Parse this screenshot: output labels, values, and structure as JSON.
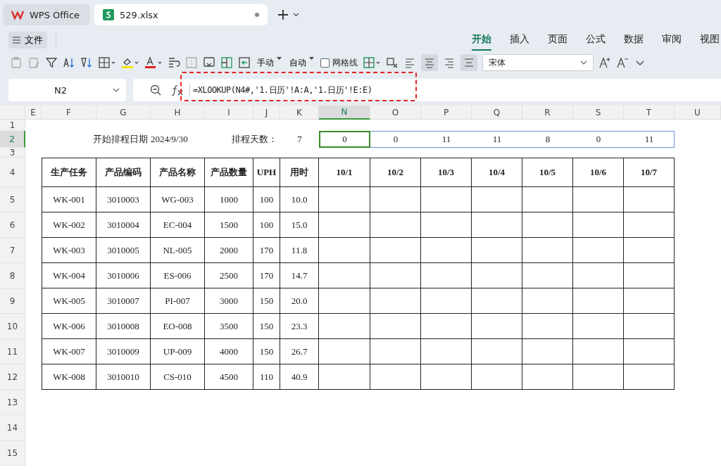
{
  "app_tabs": [
    {
      "kind": "home",
      "label": "WPS Office",
      "selected": false
    },
    {
      "kind": "file",
      "label": "529.xlsx",
      "selected": true
    }
  ],
  "menu_button": "文件",
  "ribbon_tabs": [
    {
      "label": "开始",
      "selected": true
    },
    {
      "label": "插入",
      "selected": false
    },
    {
      "label": "页面",
      "selected": false
    },
    {
      "label": "公式",
      "selected": false
    },
    {
      "label": "数据",
      "selected": false
    },
    {
      "label": "审阅",
      "selected": false
    },
    {
      "label": "视图",
      "selected": false
    }
  ],
  "toolbar": {
    "row_height": "手动",
    "col_width": "自动",
    "gridlines": {
      "label": "网格线",
      "checked": false
    },
    "font": "宋体"
  },
  "name_box": "N2",
  "formula": "=XLOOKUP(N4#,'1.日历'!A:A,'1.日历'!E:E)",
  "column_headers": [
    {
      "label": "E",
      "selected": false
    },
    {
      "label": "F",
      "selected": false
    },
    {
      "label": "G",
      "selected": false
    },
    {
      "label": "H",
      "selected": false
    },
    {
      "label": "I",
      "selected": false
    },
    {
      "label": "J",
      "selected": false
    },
    {
      "label": "K",
      "selected": false
    },
    {
      "label": "N",
      "selected": true
    },
    {
      "label": "O",
      "selected": false
    },
    {
      "label": "P",
      "selected": false
    },
    {
      "label": "Q",
      "selected": false
    },
    {
      "label": "R",
      "selected": false
    },
    {
      "label": "S",
      "selected": false
    },
    {
      "label": "T",
      "selected": false
    },
    {
      "label": "U",
      "selected": false
    }
  ],
  "row_headers": [
    {
      "label": "1",
      "selected": false
    },
    {
      "label": "2",
      "selected": true
    },
    {
      "label": "3",
      "selected": false
    },
    {
      "label": "4",
      "selected": false
    },
    {
      "label": "5",
      "selected": false
    },
    {
      "label": "6",
      "selected": false
    },
    {
      "label": "7",
      "selected": false
    },
    {
      "label": "8",
      "selected": false
    },
    {
      "label": "9",
      "selected": false
    },
    {
      "label": "10",
      "selected": false
    },
    {
      "label": "11",
      "selected": false
    },
    {
      "label": "12",
      "selected": false
    },
    {
      "label": "13",
      "selected": false
    },
    {
      "label": "14",
      "selected": false
    },
    {
      "label": "15",
      "selected": false
    }
  ],
  "schedule": {
    "start_label": "开始排程日期",
    "start_date": "2024/9/30",
    "days_label": "排程天数：",
    "days": "7",
    "day_values": [
      "0",
      "0",
      "11",
      "11",
      "8",
      "0",
      "11"
    ]
  },
  "table": {
    "columns": [
      "生产任务",
      "产品编码",
      "产品名称",
      "产品数量",
      "UPH",
      "用时"
    ],
    "dates": [
      "10/1",
      "10/2",
      "10/3",
      "10/4",
      "10/5",
      "10/6",
      "10/7"
    ],
    "rows": [
      [
        "WK-001",
        "3010003",
        "WG-003",
        "1000",
        "100",
        "10.0"
      ],
      [
        "WK-002",
        "3010004",
        "EC-004",
        "1500",
        "100",
        "15.0"
      ],
      [
        "WK-003",
        "3010005",
        "NL-005",
        "2000",
        "170",
        "11.8"
      ],
      [
        "WK-004",
        "3010006",
        "ES-006",
        "2500",
        "170",
        "14.7"
      ],
      [
        "WK-005",
        "3010007",
        "PI-007",
        "3000",
        "150",
        "20.0"
      ],
      [
        "WK-006",
        "3010008",
        "EO-008",
        "3500",
        "150",
        "23.3"
      ],
      [
        "WK-007",
        "3010009",
        "UP-009",
        "4000",
        "150",
        "26.7"
      ],
      [
        "WK-008",
        "3010010",
        "CS-010",
        "4500",
        "110",
        "40.9"
      ]
    ]
  }
}
